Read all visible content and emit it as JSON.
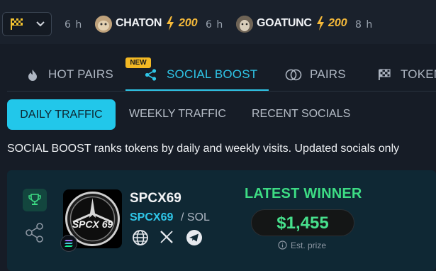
{
  "topbar": {
    "filter": {
      "icon": "checkered-flag-icon"
    },
    "ticker": [
      {
        "time": "6 h"
      },
      {
        "name": "CHATON",
        "amount": "200",
        "time": "6 h"
      },
      {
        "name": "GOATUNC",
        "amount": "200",
        "time": "8 h"
      }
    ]
  },
  "tabs": {
    "items": [
      {
        "label": "HOT PAIRS",
        "icon": "flame-icon"
      },
      {
        "label": "SOCIAL BOOST",
        "icon": "share-icon",
        "badge": "NEW"
      },
      {
        "label": "PAIRS",
        "icon": "pairs-icon"
      },
      {
        "label": "TOKEN",
        "icon": "checkered-flag-icon"
      }
    ],
    "active": "SOCIAL BOOST"
  },
  "subtabs": [
    "DAILY TRAFFIC",
    "WEEKLY TRAFFIC",
    "RECENT SOCIALS"
  ],
  "description": "SOCIAL BOOST ranks tokens by daily and weekly visits. Updated socials only",
  "card": {
    "token_name": "SPCX69",
    "symbol": "SPCX69",
    "chain": "/ SOL",
    "logo_text": "SPCX 69",
    "socials": [
      "globe-icon",
      "x-icon",
      "telegram-icon"
    ],
    "headline": "LATEST WINNER",
    "prize": "$1,455",
    "prize_note": "Est. prize"
  },
  "colors": {
    "accent": "#22c7ea",
    "gold": "#f5b93a",
    "green": "#3ddc84"
  }
}
